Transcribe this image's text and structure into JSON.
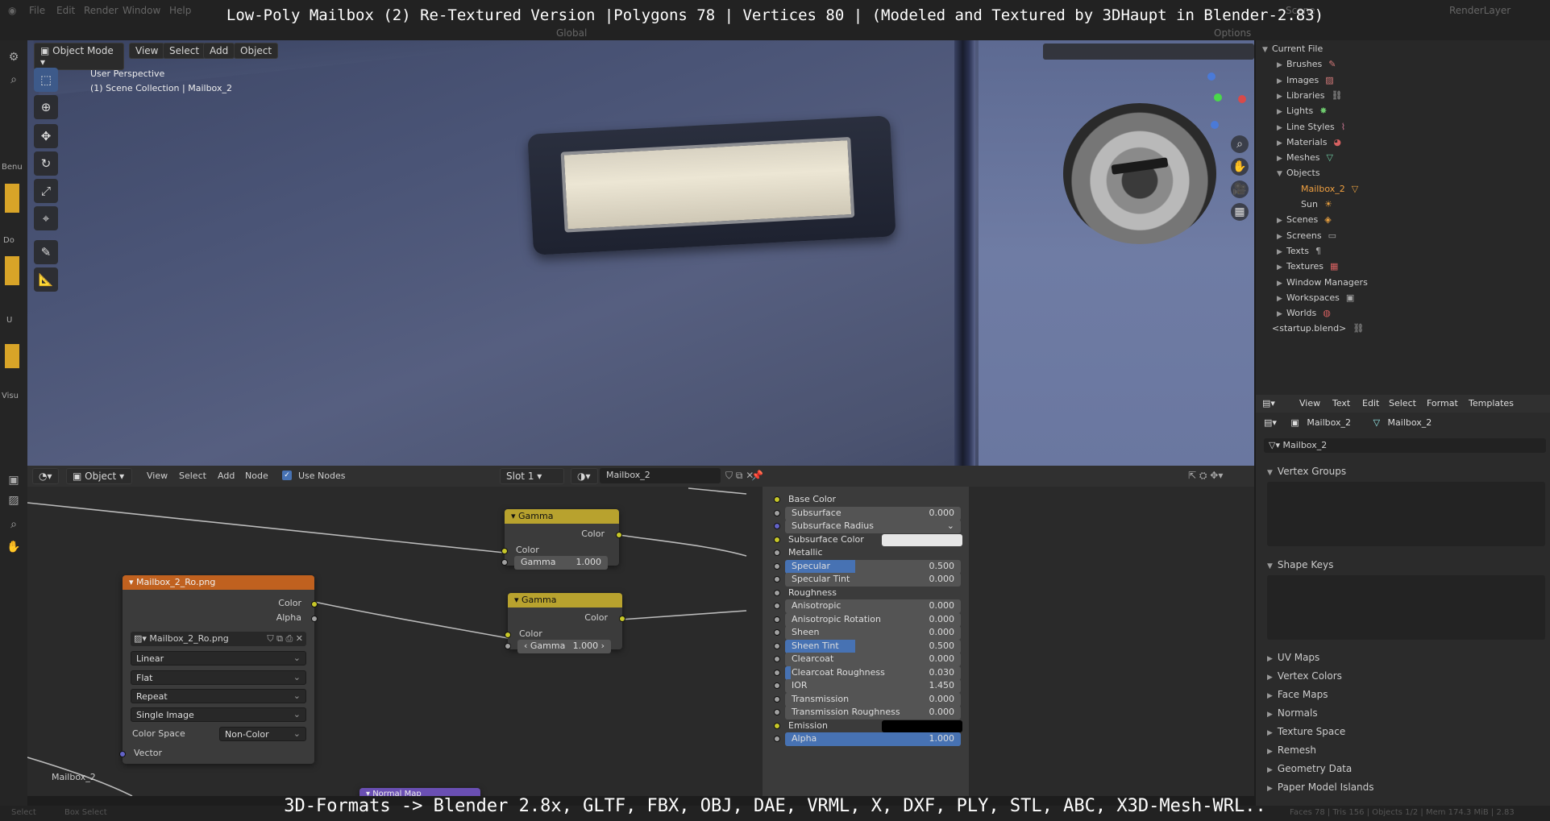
{
  "banner": {
    "top": "Low-Poly Mailbox (2) Re-Textured Version |Polygons 78 | Vertices 80 | (Modeled and Textured by 3DHaupt in Blender-2.83)",
    "bottom": "3D-Formats -> Blender 2.8x, GLTF, FBX, OBJ, DAE, VRML, X, DXF, PLY, STL, ABC, X3D-Mesh-WRL.."
  },
  "topmenu": {
    "file": "File",
    "edit": "Edit",
    "render": "Render",
    "window": "Window",
    "help": "Help",
    "global": "Global",
    "options": "Options",
    "scene": "Scene",
    "render_layer": "RenderLayer"
  },
  "viewport": {
    "mode": "Object Mode",
    "menus": [
      "View",
      "Select",
      "Add",
      "Object"
    ],
    "perspective": "User Perspective",
    "collection": "(1) Scene Collection | Mailbox_2"
  },
  "left_strip_labels": [
    "Benu",
    "Do",
    "U",
    "Visu"
  ],
  "outliner": {
    "items": [
      {
        "label": "Current File",
        "indent": 0,
        "open": true
      },
      {
        "label": "Brushes",
        "indent": 1,
        "icon": "brush-icon",
        "color": "#d47a7a"
      },
      {
        "label": "Images",
        "indent": 1,
        "icon": "image-icon",
        "color": "#d47a7a"
      },
      {
        "label": "Libraries",
        "indent": 1,
        "icon": "link-icon",
        "color": "#aaaaaa"
      },
      {
        "label": "Lights",
        "indent": 1,
        "icon": "light-icon",
        "color": "#6ec96e"
      },
      {
        "label": "Line Styles",
        "indent": 1,
        "icon": "linestyle-icon",
        "color": "#d47a9a"
      },
      {
        "label": "Materials",
        "indent": 1,
        "icon": "material-icon",
        "color": "#d46060"
      },
      {
        "label": "Meshes",
        "indent": 1,
        "icon": "mesh-icon",
        "color": "#6ec9a0"
      },
      {
        "label": "Objects",
        "indent": 1,
        "icon": "",
        "color": "#cfcfcf",
        "open": true
      },
      {
        "label": "Mailbox_2",
        "indent": 2,
        "icon": "object-icon",
        "color": "#e8a040",
        "selected": true
      },
      {
        "label": "Sun",
        "indent": 2,
        "icon": "sun-icon",
        "color": "#e8a040"
      },
      {
        "label": "Scenes",
        "indent": 1,
        "icon": "scene-icon",
        "color": "#e8a040"
      },
      {
        "label": "Screens",
        "indent": 1,
        "icon": "screen-icon",
        "color": "#aaaaaa"
      },
      {
        "label": "Texts",
        "indent": 1,
        "icon": "text-icon",
        "color": "#aaaaaa"
      },
      {
        "label": "Textures",
        "indent": 1,
        "icon": "texture-icon",
        "color": "#d46060"
      },
      {
        "label": "Window Managers",
        "indent": 1,
        "icon": "",
        "color": "#aaaaaa"
      },
      {
        "label": "Workspaces",
        "indent": 1,
        "icon": "workspace-icon",
        "color": "#aaaaaa"
      },
      {
        "label": "Worlds",
        "indent": 1,
        "icon": "world-icon",
        "color": "#d46060"
      },
      {
        "label": "<startup.blend>",
        "indent": 0,
        "icon": "link-icon",
        "color": "#aaaaaa"
      }
    ]
  },
  "props_header": {
    "menus": [
      "View",
      "Text",
      "Edit",
      "Select",
      "Format",
      "Templates"
    ]
  },
  "properties": {
    "object_name": "Mailbox_2",
    "mesh_name": "Mailbox_2",
    "data_name": "Mailbox_2",
    "sections": {
      "vertex_groups": "Vertex Groups",
      "shape_keys": "Shape Keys",
      "uv_maps": "UV Maps",
      "vertex_colors": "Vertex Colors",
      "face_maps": "Face Maps",
      "normals": "Normals",
      "texture_space": "Texture Space",
      "remesh": "Remesh",
      "geometry_data": "Geometry Data",
      "paper_model_islands": "Paper Model Islands"
    }
  },
  "node_editor": {
    "header": {
      "editor": "Object",
      "menus": [
        "View",
        "Select",
        "Add",
        "Node"
      ],
      "use_nodes": "Use Nodes",
      "slot": "Slot 1",
      "material": "Mailbox_2"
    },
    "gamma1": {
      "title": "Gamma",
      "out": "Color",
      "in": "Color",
      "gamma_label": "Gamma",
      "gamma_val": "1.000"
    },
    "gamma2": {
      "title": "Gamma",
      "out": "Color",
      "in": "Color",
      "gamma_label": "Gamma",
      "gamma_val": "1.000"
    },
    "tex": {
      "title": "Mailbox_2_Ro.png",
      "out_color": "Color",
      "out_alpha": "Alpha",
      "image": "Mailbox_2_Ro.png",
      "interp": "Linear",
      "proj": "Flat",
      "ext": "Repeat",
      "source": "Single Image",
      "cs_label": "Color Space",
      "cs_val": "Non-Color",
      "vector": "Vector"
    },
    "frame_label": "Mailbox_2",
    "normal_map": "Normal Map",
    "principled": [
      {
        "label": "Base Color",
        "type": "socket",
        "sock": "yellow"
      },
      {
        "label": "Subsurface",
        "type": "field",
        "value": "0.000",
        "fill": 0
      },
      {
        "label": "Subsurface Radius",
        "type": "dropdown"
      },
      {
        "label": "Subsurface Color",
        "type": "color",
        "color": "#e6e6e6"
      },
      {
        "label": "Metallic",
        "type": "socket",
        "sock": "gray"
      },
      {
        "label": "Specular",
        "type": "field",
        "value": "0.500",
        "fill": 0.4
      },
      {
        "label": "Specular Tint",
        "type": "field",
        "value": "0.000",
        "fill": 0
      },
      {
        "label": "Roughness",
        "type": "socket",
        "sock": "gray"
      },
      {
        "label": "Anisotropic",
        "type": "field",
        "value": "0.000",
        "fill": 0
      },
      {
        "label": "Anisotropic Rotation",
        "type": "field",
        "value": "0.000",
        "fill": 0
      },
      {
        "label": "Sheen",
        "type": "field",
        "value": "0.000",
        "fill": 0
      },
      {
        "label": "Sheen Tint",
        "type": "field",
        "value": "0.500",
        "fill": 0.4
      },
      {
        "label": "Clearcoat",
        "type": "field",
        "value": "0.000",
        "fill": 0
      },
      {
        "label": "Clearcoat Roughness",
        "type": "field",
        "value": "0.030",
        "fill": 0.03
      },
      {
        "label": "IOR",
        "type": "field",
        "value": "1.450",
        "fill": 0
      },
      {
        "label": "Transmission",
        "type": "field",
        "value": "0.000",
        "fill": 0
      },
      {
        "label": "Transmission Roughness",
        "type": "field",
        "value": "0.000",
        "fill": 0
      },
      {
        "label": "Emission",
        "type": "color",
        "color": "#000000"
      },
      {
        "label": "Alpha",
        "type": "field",
        "value": "1.000",
        "fill": 1
      }
    ]
  },
  "status": {
    "select": "Select",
    "box_select": "Box Select",
    "stats": "Faces 78 | Tris 156 | Objects 1/2 | Mem 174.3 MiB | 2.83"
  }
}
